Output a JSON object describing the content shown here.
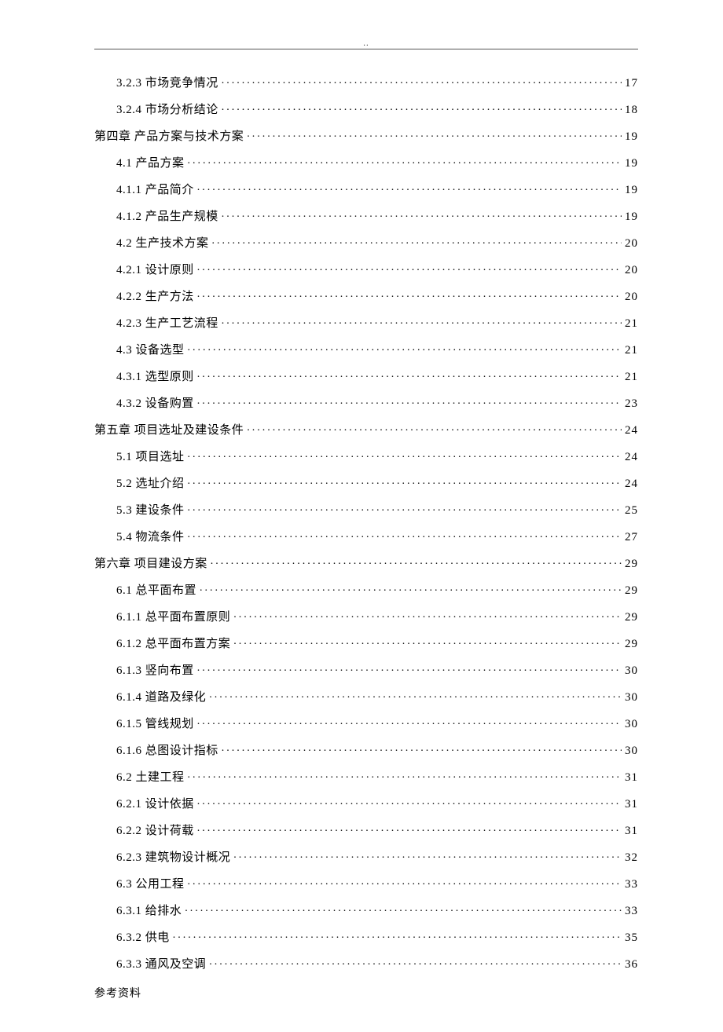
{
  "header_mark": "..",
  "footer": "参考资料",
  "toc": [
    {
      "level": 2,
      "label": "3.2.3 市场竞争情况",
      "page": "17"
    },
    {
      "level": 2,
      "label": "3.2.4 市场分析结论",
      "page": "18"
    },
    {
      "level": 0,
      "label": "第四章 产品方案与技术方案",
      "page": "19"
    },
    {
      "level": 1,
      "label": "4.1 产品方案",
      "page": "19"
    },
    {
      "level": 2,
      "label": "4.1.1 产品简介",
      "page": "19"
    },
    {
      "level": 2,
      "label": "4.1.2 产品生产规模",
      "page": "19"
    },
    {
      "level": 1,
      "label": "4.2 生产技术方案",
      "page": "20"
    },
    {
      "level": 2,
      "label": "4.2.1 设计原则",
      "page": "20"
    },
    {
      "level": 2,
      "label": "4.2.2 生产方法",
      "page": "20"
    },
    {
      "level": 2,
      "label": "4.2.3 生产工艺流程",
      "page": "21"
    },
    {
      "level": 1,
      "label": "4.3 设备选型",
      "page": "21"
    },
    {
      "level": 2,
      "label": "4.3.1 选型原则",
      "page": "21"
    },
    {
      "level": 2,
      "label": "4.3.2 设备购置",
      "page": "23"
    },
    {
      "level": 0,
      "label": "第五章 项目选址及建设条件",
      "page": "24"
    },
    {
      "level": 1,
      "label": "5.1 项目选址",
      "page": "24"
    },
    {
      "level": 1,
      "label": "5.2 选址介绍",
      "page": "24"
    },
    {
      "level": 1,
      "label": "5.3 建设条件",
      "page": "25"
    },
    {
      "level": 1,
      "label": "5.4 物流条件",
      "page": "27"
    },
    {
      "level": 0,
      "label": "第六章 项目建设方案",
      "page": "29"
    },
    {
      "level": 1,
      "label": "6.1 总平面布置",
      "page": "29"
    },
    {
      "level": 2,
      "label": "6.1.1 总平面布置原则",
      "page": "29"
    },
    {
      "level": 2,
      "label": "6.1.2 总平面布置方案",
      "page": "29"
    },
    {
      "level": 2,
      "label": "6.1.3 竖向布置",
      "page": "30"
    },
    {
      "level": 2,
      "label": "6.1.4 道路及绿化",
      "page": "30"
    },
    {
      "level": 2,
      "label": "6.1.5 管线规划",
      "page": "30"
    },
    {
      "level": 2,
      "label": "6.1.6 总图设计指标",
      "page": "30"
    },
    {
      "level": 1,
      "label": "6.2 土建工程",
      "page": "31"
    },
    {
      "level": 2,
      "label": "6.2.1 设计依据",
      "page": "31"
    },
    {
      "level": 2,
      "label": "6.2.2 设计荷载",
      "page": "31"
    },
    {
      "level": 2,
      "label": "6.2.3 建筑物设计概况",
      "page": "32"
    },
    {
      "level": 1,
      "label": "6.3 公用工程",
      "page": "33"
    },
    {
      "level": 2,
      "label": "6.3.1 给排水",
      "page": "33"
    },
    {
      "level": 2,
      "label": "6.3.2 供电",
      "page": "35"
    },
    {
      "level": 2,
      "label": "6.3.3 通风及空调",
      "page": "36"
    }
  ]
}
